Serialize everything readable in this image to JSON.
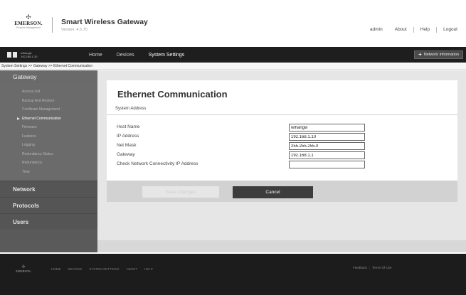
{
  "header": {
    "logo_mark": "✣",
    "logo_word": "EMERSON.",
    "logo_sub": "Process Management",
    "product_title": "Smart Wireless Gateway",
    "version": "Version: 4.5.70",
    "user": "admin",
    "links": [
      "About",
      "Help",
      "Logout"
    ]
  },
  "topnav": {
    "gateway_name": "wihangw",
    "gateway_ip": "192.168.1.10",
    "items": [
      "Home",
      "Devices",
      "System Settings"
    ],
    "active_item": "System Settings",
    "network_info_label": "Network Information"
  },
  "breadcrumb": "System Settings >> Gateway >> Ethernet Communication",
  "sidebar": {
    "gateway_header": "Gateway",
    "items": [
      {
        "label": "Access List",
        "active": false
      },
      {
        "label": "Backup And Restore",
        "active": false
      },
      {
        "label": "Certificate Management",
        "active": false
      },
      {
        "label": "Ethernet Communication",
        "active": true
      },
      {
        "label": "Firmware",
        "active": false
      },
      {
        "label": "Features",
        "active": false
      },
      {
        "label": "Logging",
        "active": false
      },
      {
        "label": "Redundancy Status",
        "active": false
      },
      {
        "label": "Redundancy",
        "active": false
      },
      {
        "label": "Time",
        "active": false
      }
    ],
    "sections": [
      "Network",
      "Protocols",
      "Users"
    ]
  },
  "main": {
    "title": "Ethernet Communication",
    "section_label": "System Address",
    "fields": [
      {
        "label": "Host Name",
        "value": "wihangw"
      },
      {
        "label": "IP Address",
        "value": "192.168.1.10"
      },
      {
        "label": "Net Mask",
        "value": "255.255.255.0"
      },
      {
        "label": "Gateway",
        "value": "192.168.1.1"
      },
      {
        "label": "Check Network Connectivity IP Address",
        "value": ""
      }
    ],
    "save_label": "Save Changes",
    "cancel_label": "Cancel"
  },
  "footer": {
    "logo_mark": "✣",
    "logo_word": "EMERSON.",
    "links": [
      "HOME",
      "DEVICES",
      "SYSTEM SETTINGS",
      "ABOUT",
      "HELP"
    ],
    "feedback": "Feedback",
    "terms": "Terms Of Use"
  },
  "colors": {
    "nav_bg": "#1e1e1e",
    "sidebar_bg": "#5a5a5a",
    "cancel_bg": "#3d3d3d",
    "footer_bg": "#1c1c1c"
  }
}
